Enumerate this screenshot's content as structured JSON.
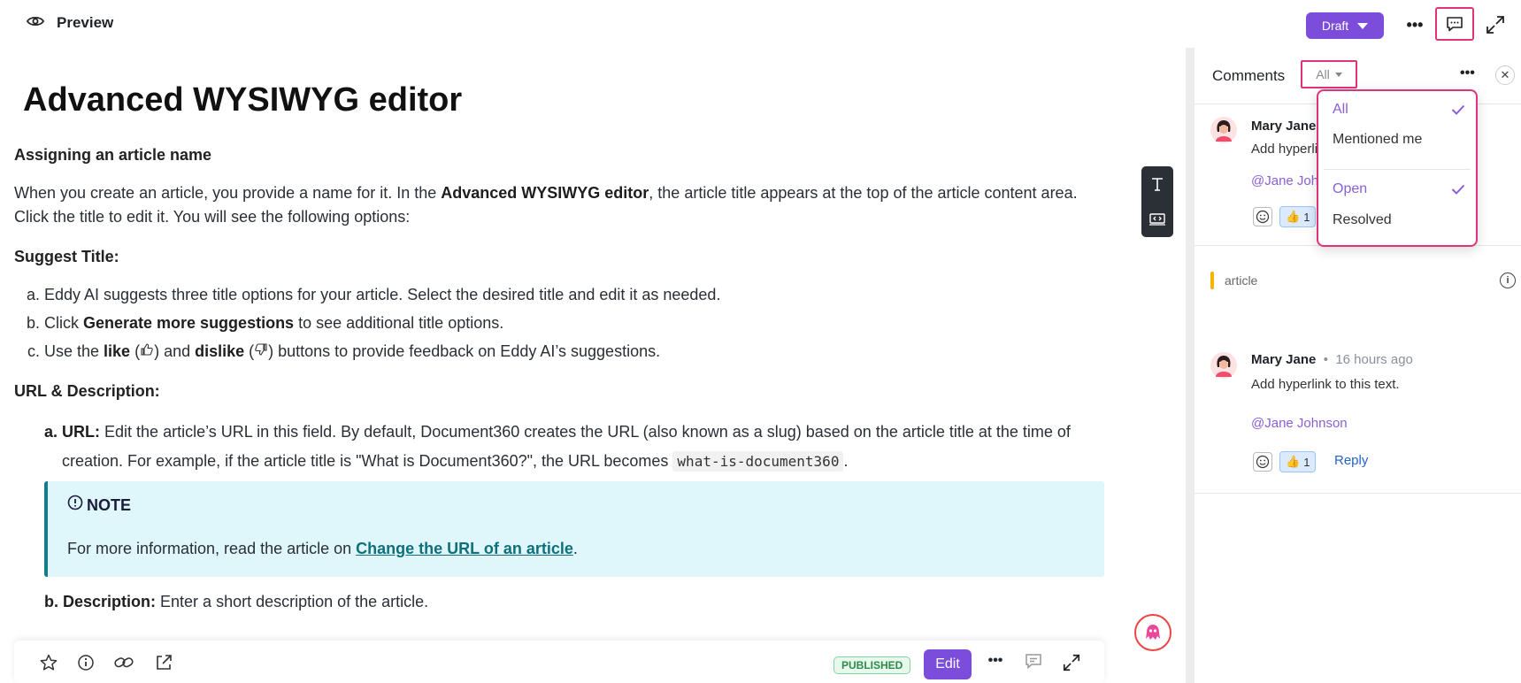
{
  "topbar": {
    "preview_label": "Preview",
    "status_button": "Draft"
  },
  "article": {
    "title": "Advanced WYSIWYG editor",
    "section1_heading": "Assigning an article name",
    "intro_pre": "When you create an article, you provide a name for it. In the ",
    "intro_bold": "Advanced WYSIWYG editor",
    "intro_post": ", the article title appears at the top of the article content area. Click the title to edit it. You will see the following options:",
    "suggest_heading": "Suggest Title:",
    "suggest_a": "Eddy AI suggests three title options for your article. Select the desired title and edit it as needed.",
    "suggest_b_pre": "Click ",
    "suggest_b_bold": "Generate more suggestions",
    "suggest_b_post": " to see additional title options.",
    "suggest_c_pre": "Use the ",
    "suggest_c_like": "like",
    "suggest_c_mid1": " (",
    "suggest_c_mid2": ") and ",
    "suggest_c_dislike": "dislike",
    "suggest_c_mid3": " (",
    "suggest_c_post": ") buttons to provide feedback on Eddy AI’s suggestions.",
    "url_heading": "URL & Description:",
    "url_marker": "a.",
    "url_label": "URL:",
    "url_text": " Edit the article’s URL in this field. By default, Document360 creates the URL (also known as a slug) based on the article title at the time of creation. For example, if the article title is \"What is Document360?\", the URL becomes ",
    "url_code": "what-is-document360",
    "url_end": ".",
    "note_label": "NOTE",
    "note_pre": "For more information, read the article on ",
    "note_link": "Change the URL of an article",
    "note_post": ".",
    "desc_marker": "b.",
    "desc_label": "Description:",
    "desc_text": " Enter a short description of the article."
  },
  "footer": {
    "status_badge": "PUBLISHED",
    "edit_button": "Edit"
  },
  "comments": {
    "title": "Comments",
    "filter_value": "All",
    "threads": [
      {
        "author": "Mary Jane",
        "text": "Add hyperlink to this text.",
        "mention": "@Jane Johnson",
        "likes": "1"
      },
      {
        "context": "article",
        "author": "Mary Jane",
        "time": "16 hours ago",
        "text": "Add hyperlink to this text.",
        "mention": "@Jane Johnson",
        "likes": "1",
        "reply": "Reply"
      }
    ],
    "filter_menu": {
      "group1": [
        {
          "label": "All",
          "selected": true
        },
        {
          "label": "Mentioned me",
          "selected": false
        }
      ],
      "group2": [
        {
          "label": "Open",
          "selected": true
        },
        {
          "label": "Resolved",
          "selected": false
        }
      ]
    }
  },
  "colors": {
    "accent": "#7c4ddb",
    "highlight": "#e0337a",
    "note_bg": "#dff6fb",
    "note_border": "#137c87",
    "mention": "#8a5fd6"
  }
}
